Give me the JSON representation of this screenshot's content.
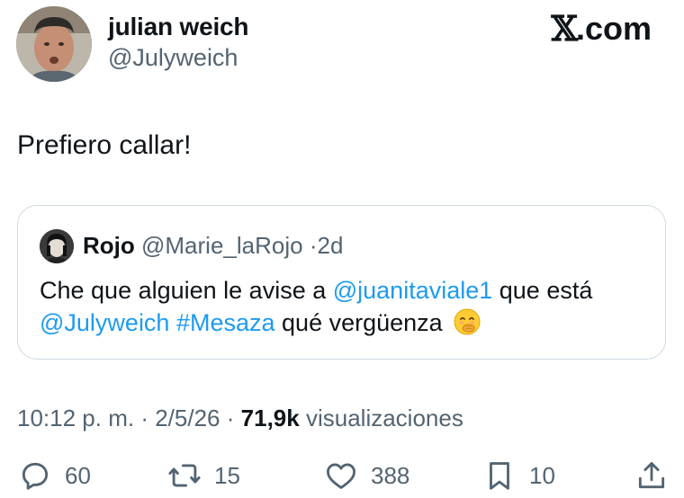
{
  "author": {
    "name": "julian weich",
    "handle": "@Julyweich"
  },
  "brand": {
    "x_glyph": "𝕏",
    "domain": ".com"
  },
  "tweet": {
    "text": "Prefiero callar!"
  },
  "quoted": {
    "name": "Rojo",
    "handle": "@Marie_laRojo",
    "separator": "·",
    "time": "2d",
    "body": {
      "line1_prefix": "Che que alguien le avise a ",
      "mention1": "@juanitaviale1",
      "line1_suffix": " que está",
      "mention2": "@Julyweich",
      "hashtag": "#Mesaza",
      "line2_suffix": " qué vergüenza",
      "emoji_icon": "face-with-hand-over-mouth-emoji"
    }
  },
  "meta": {
    "time": "10:12 p. m.",
    "date": "2/5/26",
    "separator": "·",
    "views_count": "71,9k",
    "views_label": "visualizaciones"
  },
  "actions": {
    "reply": {
      "count": "60",
      "icon": "reply-icon"
    },
    "retweet": {
      "count": "15",
      "icon": "retweet-icon"
    },
    "like": {
      "count": "388",
      "icon": "heart-icon"
    },
    "bookmark": {
      "count": "10",
      "icon": "bookmark-icon"
    },
    "share": {
      "icon": "share-icon"
    }
  },
  "colors": {
    "text": "#0f1419",
    "secondary": "#536471",
    "link": "#1d9bf0",
    "border": "#cfd9de"
  }
}
